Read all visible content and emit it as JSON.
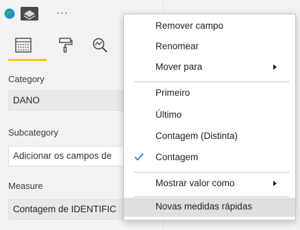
{
  "toolbar": {
    "more_label": "···"
  },
  "fields": {
    "category_label": "Category",
    "category_value": "DANO",
    "subcategory_label": "Subcategory",
    "subcategory_placeholder": "Adicionar os campos de",
    "measure_label": "Measure",
    "measure_value": "Contagem de IDENTIFIC"
  },
  "menu": {
    "items": [
      {
        "label": "Remover campo"
      },
      {
        "label": "Renomear"
      },
      {
        "label": "Mover para",
        "submenu": true
      },
      {
        "label": "Primeiro"
      },
      {
        "label": "Último"
      },
      {
        "label": "Contagem (Distinta)"
      },
      {
        "label": "Contagem",
        "checked": true
      },
      {
        "label": "Mostrar valor como",
        "submenu": true
      },
      {
        "label": "Novas medidas rápidas",
        "hovered": true
      }
    ]
  },
  "colors": {
    "accent_underline": "#f2c811",
    "check": "#2b7bb9",
    "hover": "#e1dfdd"
  },
  "icons": [
    "globe-icon",
    "paint-layers-icon",
    "fields-icon",
    "format-paint-roller-icon",
    "analytics-magnifier-icon",
    "chevron-right-icon",
    "checkmark-icon"
  ]
}
